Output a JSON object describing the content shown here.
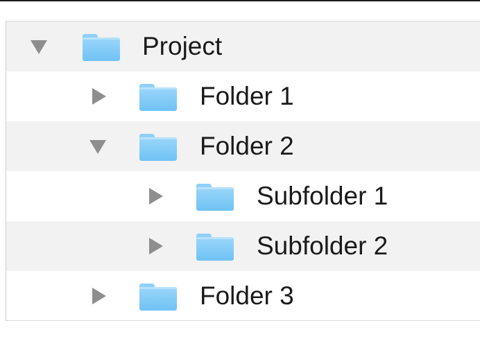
{
  "tree": {
    "rows": [
      {
        "label": "Project",
        "expanded": true,
        "level": 0,
        "icon": "folder-icon"
      },
      {
        "label": "Folder 1",
        "expanded": false,
        "level": 1,
        "icon": "folder-icon"
      },
      {
        "label": "Folder 2",
        "expanded": true,
        "level": 1,
        "icon": "folder-icon"
      },
      {
        "label": "Subfolder 1",
        "expanded": false,
        "level": 2,
        "icon": "folder-icon"
      },
      {
        "label": "Subfolder 2",
        "expanded": false,
        "level": 2,
        "icon": "folder-icon"
      },
      {
        "label": "Folder 3",
        "expanded": false,
        "level": 1,
        "icon": "folder-icon"
      }
    ]
  },
  "colors": {
    "folder": "#7ec8f6",
    "disclosure": "#8e8e8e",
    "row_alt": "#f2f2f2"
  }
}
